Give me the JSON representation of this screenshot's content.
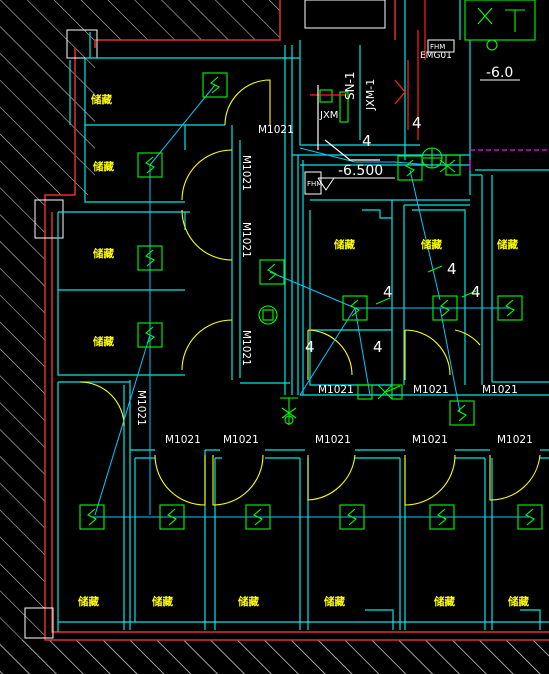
{
  "storage_label": "储藏",
  "door_label": "M1021",
  "elevation_labels": {
    "upper_right": "-6.0",
    "middle": "-6.500"
  },
  "number_marks": {
    "four": "4"
  },
  "pipe_tags": {
    "sn": "SN-1",
    "jxm_vertical": "JXM-1",
    "jxm_horizontal": "JXM",
    "emg": "EMG01",
    "fhm": "FHM"
  },
  "colors": {
    "background": "#000000",
    "hatch": "#ffffff",
    "wall_outer": "#e03030",
    "wall_inner": "#00e5e5",
    "door_swing": "#ffff00",
    "device": "#00ff00",
    "wire": "#00c8ff",
    "pipe_red": "#ff2020",
    "pipe_magenta": "#ff00ff",
    "text_white": "#ffffff"
  },
  "icons": {
    "fan_unit": "sprinkler-box-icon",
    "valve": "valve-icon",
    "fire_hydrant": "fire-hydrant-icon"
  }
}
